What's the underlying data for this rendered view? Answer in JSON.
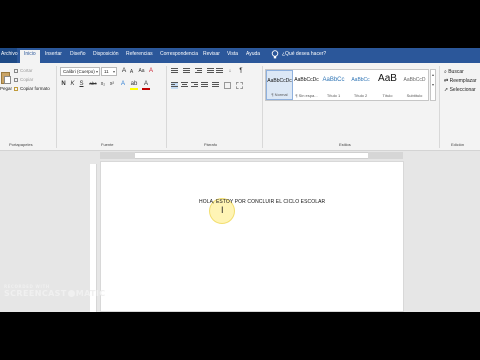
{
  "tabs": [
    {
      "label": "Archivo"
    },
    {
      "label": "Inicio"
    },
    {
      "label": "Insertar"
    },
    {
      "label": "Diseño"
    },
    {
      "label": "Disposición"
    },
    {
      "label": "Referencias"
    },
    {
      "label": "Correspondencia"
    },
    {
      "label": "Revisar"
    },
    {
      "label": "Vista"
    },
    {
      "label": "Ayuda"
    }
  ],
  "tell_me": "¿Qué desea hacer?",
  "clipboard": {
    "paste_label": "Pegar",
    "cut_label": "Cortar",
    "copy_label": "Copiar",
    "format_painter_label": "Copiar formato",
    "group_label": "Portapapeles"
  },
  "font": {
    "family_value": "Calibri (Cuerpo)",
    "size_value": "11",
    "grow_icon": "A",
    "shrink_icon": "A",
    "case_icon": "Aa",
    "clear_icon": "A",
    "bold": "N",
    "italic": "K",
    "underline": "S",
    "strike": "abc",
    "subscript": "x₂",
    "superscript": "x²",
    "text_effects": "A",
    "highlight_color": "#ffff00",
    "font_color": "#c00000",
    "group_label": "Fuente"
  },
  "paragraph": {
    "pilcrow": "¶",
    "group_label": "Párrafo"
  },
  "styles": {
    "items": [
      {
        "preview": "AaBbCcDc",
        "label": "¶ Normal"
      },
      {
        "preview": "AaBbCcDc",
        "label": "¶ Sin espa..."
      },
      {
        "preview": "AaBbCc",
        "label": "Título 1"
      },
      {
        "preview": "AaBbCc",
        "label": "Título 2"
      },
      {
        "preview": "AaB",
        "label": "Título"
      },
      {
        "preview": "AaBbCcD",
        "label": "Subtítulo"
      }
    ],
    "group_label": "Estilos"
  },
  "editing": {
    "find_label": "Buscar",
    "replace_label": "Reemplazar",
    "select_label": "Seleccionar",
    "group_label": "Edición"
  },
  "document": {
    "text": "HOLA, ESTOY POR CONCLUIR EL CICLO ESCOLAR"
  },
  "watermark": {
    "line1": "RECORDED WITH",
    "line2_left": "SCREENCAST",
    "line2_right": "MATIC"
  }
}
